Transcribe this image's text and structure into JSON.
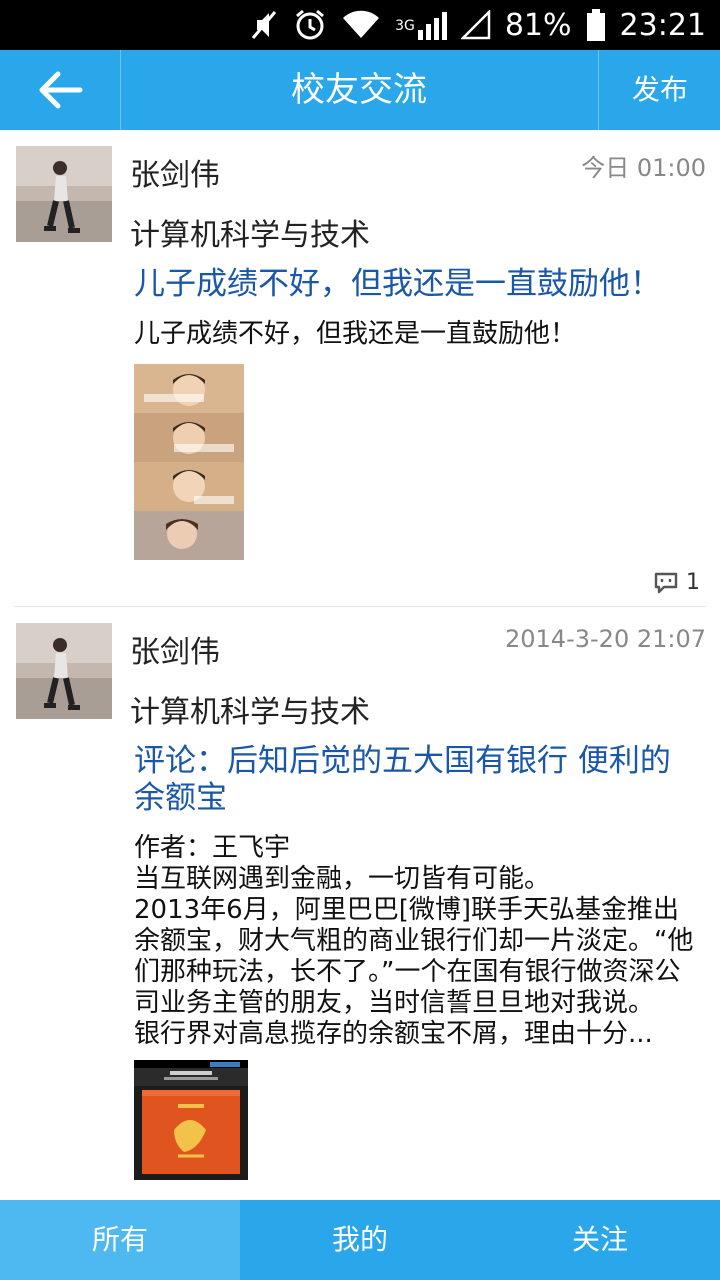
{
  "status_bar": {
    "network": "3G",
    "battery": "81%",
    "time": "23:21",
    "icons": [
      "mute-icon",
      "alarm-icon",
      "wifi-icon",
      "signal-icon",
      "battery-icon"
    ]
  },
  "header": {
    "title": "校友交流",
    "publish_label": "发布",
    "back_icon": "back-arrow-icon",
    "color": "#2aa7ea"
  },
  "posts": [
    {
      "author": "张剑伟",
      "major": "计算机科学与技术",
      "time": "今日 01:00",
      "title": "儿子成绩不好，但我还是一直鼓励他！",
      "body": "儿子成绩不好，但我还是一直鼓励他！",
      "comment_count": "1"
    },
    {
      "author": "张剑伟",
      "major": "计算机科学与技术",
      "time": "2014-3-20 21:07",
      "title": "评论：后知后觉的五大国有银行 便利的余额宝",
      "body_lines": [
        "作者：王飞宇",
        "当互联网遇到金融，一切皆有可能。",
        "2013年6月，阿里巴巴[微博]联手天弘基金推出余额宝，财大气粗的商业银行们却一片淡定。“他们那种玩法，长不了。”一个在国有银行做资深公司业务主管的朋友，当时信誓旦旦地对我说。",
        "银行界对高息揽存的余额宝不屑，理由十分..."
      ]
    }
  ],
  "tabs": [
    {
      "label": "所有",
      "active": true
    },
    {
      "label": "我的",
      "active": false
    },
    {
      "label": "关注",
      "active": false
    }
  ]
}
